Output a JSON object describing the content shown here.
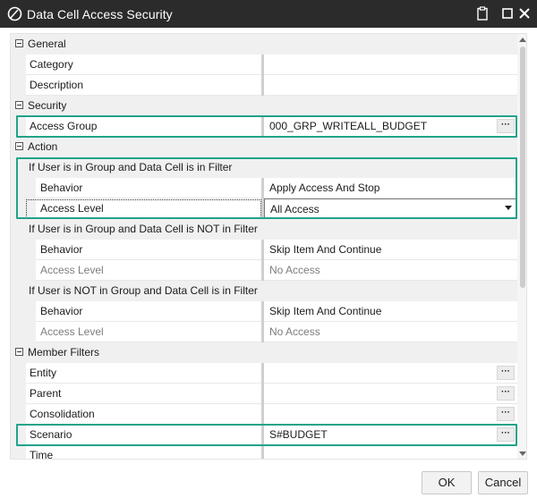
{
  "window": {
    "title": "Data Cell Access Security"
  },
  "sections": {
    "general": "General",
    "security": "Security",
    "action": "Action",
    "member_filters": "Member Filters"
  },
  "rows": {
    "category": {
      "label": "Category",
      "value": ""
    },
    "description": {
      "label": "Description",
      "value": ""
    },
    "access_group": {
      "label": "Access Group",
      "value": "000_GRP_WRITEALL_BUDGET"
    },
    "group_in_filter_header": "If User is in Group and Data Cell is in Filter",
    "behavior_1": {
      "label": "Behavior",
      "value": "Apply Access And Stop"
    },
    "access_level_1": {
      "label": "Access Level",
      "value": "All Access"
    },
    "group_not_filter_header": "If User is in Group and Data Cell is NOT in Filter",
    "behavior_2": {
      "label": "Behavior",
      "value": "Skip Item And Continue"
    },
    "access_level_2": {
      "label": "Access Level",
      "value": "No Access"
    },
    "not_group_filter_header": "If User is NOT in Group and Data Cell is in Filter",
    "behavior_3": {
      "label": "Behavior",
      "value": "Skip Item And Continue"
    },
    "access_level_3": {
      "label": "Access Level",
      "value": "No Access"
    },
    "entity": {
      "label": "Entity",
      "value": ""
    },
    "parent": {
      "label": "Parent",
      "value": ""
    },
    "consolidation": {
      "label": "Consolidation",
      "value": ""
    },
    "scenario": {
      "label": "Scenario",
      "value": "S#BUDGET"
    },
    "time": {
      "label": "Time",
      "value": ""
    }
  },
  "ellipsis": "···",
  "buttons": {
    "ok": "OK",
    "cancel": "Cancel"
  },
  "colors": {
    "highlight": "#21a38a",
    "titlebar": "#2b2b2b"
  }
}
